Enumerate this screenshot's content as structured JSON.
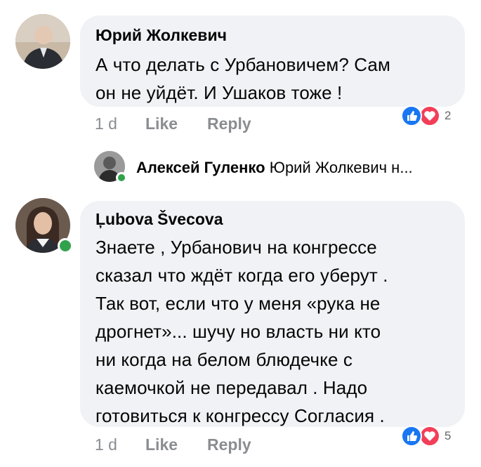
{
  "comments": [
    {
      "author": "Юрий Жолкевич",
      "lines": [
        "А что делать с Урбановичем? Сам",
        "он не уйдёт. И Ушаков тоже !"
      ],
      "time": "1 d",
      "like_label": "Like",
      "reply_label": "Reply",
      "reaction_count": "2",
      "reaction_icons": [
        "like-icon",
        "love-icon"
      ]
    },
    {
      "author": "Ļubova Švecova",
      "lines": [
        "Знаете , Урбанович на конгрессе",
        "сказал что ждёт когда его уберут .",
        "Так вот, если что у меня «рука не",
        "дрогнет»... шучу но власть ни кто",
        "ни когда на белом блюдечке с",
        "каемочкой не передавал . Надо",
        "готовиться к конгрессу Согласия ."
      ],
      "time": "1 d",
      "like_label": "Like",
      "reply_label": "Reply",
      "reaction_count": "5",
      "reaction_icons": [
        "like-icon",
        "love-icon"
      ]
    }
  ],
  "reply_preview": {
    "author": "Алексей Гуленко",
    "text": "Юрий Жолкевич н..."
  },
  "colors": {
    "bubble": "#f0f2f5",
    "like_blue": "#1877f2",
    "love_red": "#f33e58",
    "online_green": "#31a24c",
    "meta_gray": "#8a8d91"
  }
}
